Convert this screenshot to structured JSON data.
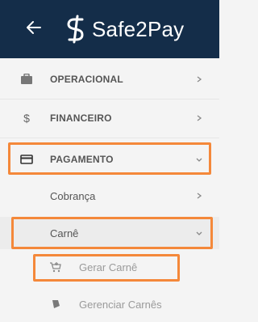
{
  "header": {
    "brand": "Safe2Pay",
    "back_icon": "arrow-left-icon",
    "background": "#142d49"
  },
  "menu": {
    "items": [
      {
        "label": "OPERACIONAL",
        "icon": "briefcase-icon"
      },
      {
        "label": "FINANCEIRO",
        "icon": "dollar-icon"
      },
      {
        "label": "PAGAMENTO",
        "icon": "credit-card-icon"
      }
    ],
    "pagamento_children": [
      {
        "label": "Cobrança"
      },
      {
        "label": "Carnê"
      }
    ],
    "carne_children": [
      {
        "label": "Gerar Carnê",
        "icon": "cart-plus-icon"
      },
      {
        "label": "Gerenciar Carnês",
        "icon": "tag-icon"
      }
    ]
  },
  "colors": {
    "highlight": "#f4883a",
    "text": "#555555",
    "muted": "#9a9a9a"
  }
}
